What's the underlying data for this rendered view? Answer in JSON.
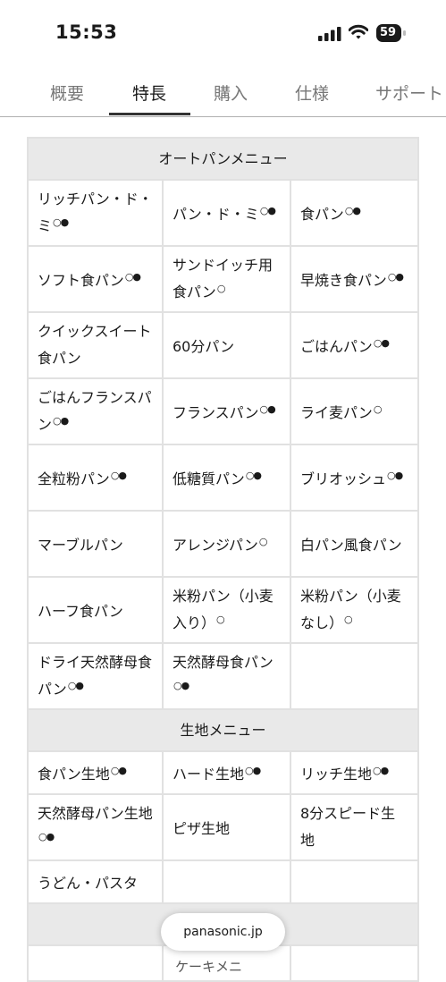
{
  "status_bar": {
    "time": "15:53",
    "battery": "59"
  },
  "tabs": [
    {
      "label": "概要",
      "active": false
    },
    {
      "label": "特長",
      "active": true
    },
    {
      "label": "購入",
      "active": false
    },
    {
      "label": "仕様",
      "active": false
    },
    {
      "label": "サポート",
      "active": false
    }
  ],
  "auto_menu": {
    "title": "オートパンメニュー",
    "rows": [
      [
        {
          "name": "リッチパン・ド・ミ",
          "marks": "○●"
        },
        {
          "name": "パン・ド・ミ",
          "marks": "○●"
        },
        {
          "name": "食パン",
          "marks": "○●"
        }
      ],
      [
        {
          "name": "ソフト食パン",
          "marks": "○●"
        },
        {
          "name": "サンドイッチ用食パン",
          "marks": "○"
        },
        {
          "name": "早焼き食パン",
          "marks": "○●"
        }
      ],
      [
        {
          "name": "クイックスイート食パン",
          "marks": ""
        },
        {
          "name": "60分パン",
          "marks": ""
        },
        {
          "name": "ごはんパン",
          "marks": "○●"
        }
      ],
      [
        {
          "name": "ごはんフランスパン",
          "marks": "○●"
        },
        {
          "name": "フランスパン",
          "marks": "○●"
        },
        {
          "name": "ライ麦パン",
          "marks": "○"
        }
      ],
      [
        {
          "name": "全粒粉パン",
          "marks": "○●"
        },
        {
          "name": "低糖質パン",
          "marks": "○●"
        },
        {
          "name": "ブリオッシュ",
          "marks": "○●"
        }
      ],
      [
        {
          "name": "マーブルパン",
          "marks": ""
        },
        {
          "name": "アレンジパン",
          "marks": "○"
        },
        {
          "name": "白パン風食パン",
          "marks": ""
        }
      ],
      [
        {
          "name": "ハーフ食パン",
          "marks": ""
        },
        {
          "name": "米粉パン（小麦入り）",
          "marks": "○"
        },
        {
          "name": "米粉パン（小麦なし）",
          "marks": "○"
        }
      ],
      [
        {
          "name": "ドライ天然酵母食パン",
          "marks": "○●"
        },
        {
          "name": "天然酵母食パン",
          "marks": "○●"
        },
        {
          "name": "",
          "marks": ""
        }
      ]
    ]
  },
  "dough_menu": {
    "title": "生地メニュー",
    "rows": [
      [
        {
          "name": "食パン生地",
          "marks": "○●"
        },
        {
          "name": "ハード生地",
          "marks": "○●"
        },
        {
          "name": "リッチ生地",
          "marks": "○●"
        }
      ],
      [
        {
          "name": "天然酵母パン生地",
          "marks": "○●"
        },
        {
          "name": "ピザ生地",
          "marks": ""
        },
        {
          "name": "8分スピード生地",
          "marks": ""
        }
      ],
      [
        {
          "name": "うどん・パスタ",
          "marks": ""
        },
        {
          "name": "",
          "marks": ""
        },
        {
          "name": "",
          "marks": ""
        }
      ]
    ]
  },
  "next_section_peek": "ケーキメニ",
  "url_bar": {
    "domain": "panasonic.jp"
  }
}
